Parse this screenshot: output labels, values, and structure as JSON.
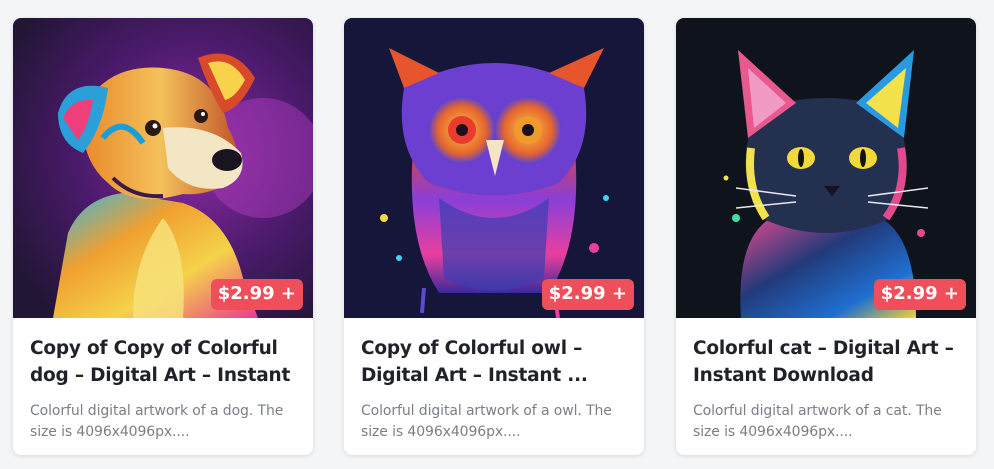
{
  "products": [
    {
      "image_icon": "dog-artwork",
      "price": "$2.99 +",
      "title_line1": "Copy of Copy of Colorful",
      "title_line2": "dog – Digital Art – Instant ...",
      "desc_line1": "Colorful digital artwork of a dog. The",
      "desc_line2": "size is 4096x4096px...."
    },
    {
      "image_icon": "owl-artwork",
      "price": "$2.99 +",
      "title_line1": "Copy of Colorful owl –",
      "title_line2": "Digital Art – Instant ...",
      "desc_line1": "Colorful digital artwork of a owl. The",
      "desc_line2": "size is 4096x4096px...."
    },
    {
      "image_icon": "cat-artwork",
      "price": "$2.99 +",
      "title_line1": "Colorful cat – Digital Art –",
      "title_line2": "Instant Download",
      "desc_line1": "Colorful digital artwork of a cat. The",
      "desc_line2": "size is 4096x4096px...."
    }
  ],
  "colors": {
    "badge": "#ef4f5b",
    "title": "#1f2329",
    "description": "#7a7f86",
    "card_bg": "#ffffff"
  }
}
